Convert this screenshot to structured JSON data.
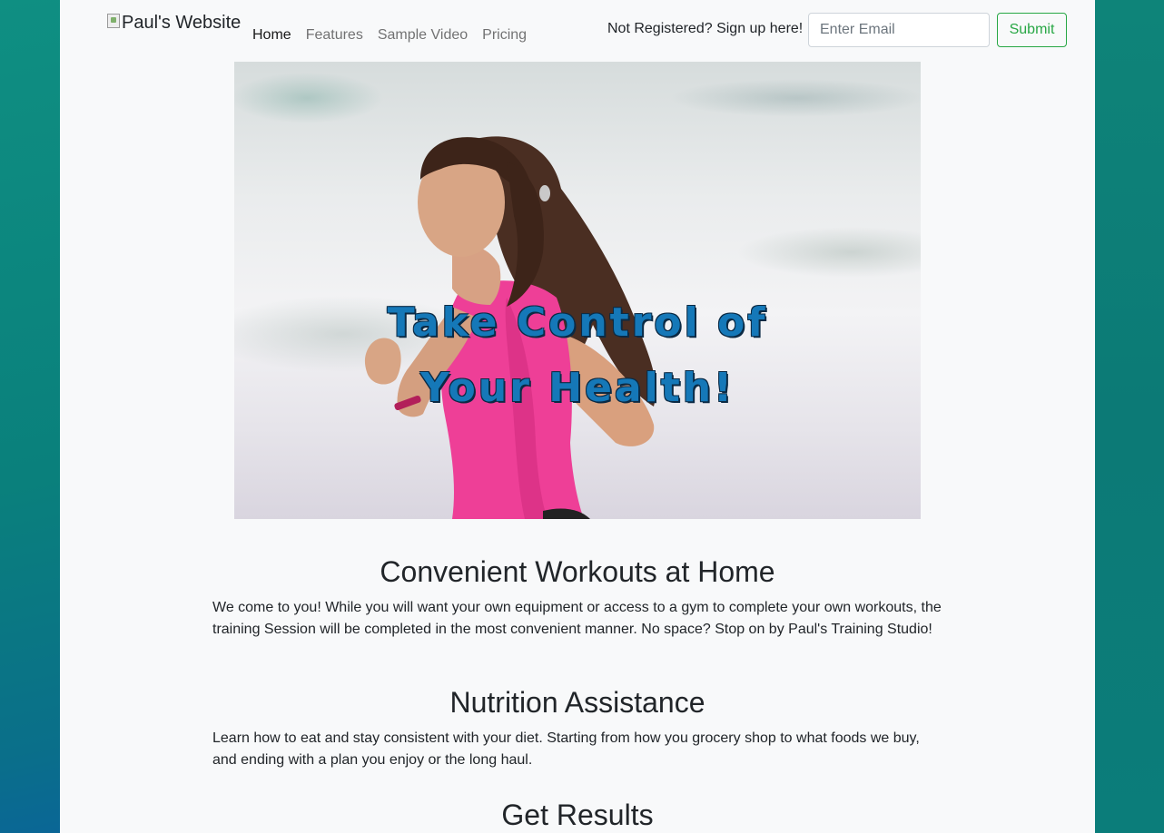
{
  "brand": {
    "logo_alt": "Paul's Website"
  },
  "nav": {
    "items": [
      {
        "label": "Home",
        "active": true
      },
      {
        "label": "Features",
        "active": false
      },
      {
        "label": "Sample Video",
        "active": false
      },
      {
        "label": "Pricing",
        "active": false
      }
    ]
  },
  "signup": {
    "prompt": "Not Registered? Sign up here!",
    "email_placeholder": "Enter Email",
    "submit_label": "Submit"
  },
  "hero": {
    "line1": "Take Control of",
    "line2": "Your Health!"
  },
  "sections": [
    {
      "title": "Convenient Workouts at Home",
      "text": "We come to you! While you will want your own equipment or access to a gym to complete your own workouts, the training Session will be completed in the most convenient manner. No space? Stop on by Paul's Training Studio!"
    },
    {
      "title": "Nutrition Assistance",
      "text": "Learn how to eat and stay consistent with your diet. Starting from how you grocery shop to what foods we buy, and ending with a plan you enjoy or the long haul."
    },
    {
      "title": "Get Results",
      "text": ""
    }
  ],
  "colors": {
    "accent_green": "#28a745",
    "hero_text": "#1578b8",
    "page_background": "#f8f9fa"
  }
}
